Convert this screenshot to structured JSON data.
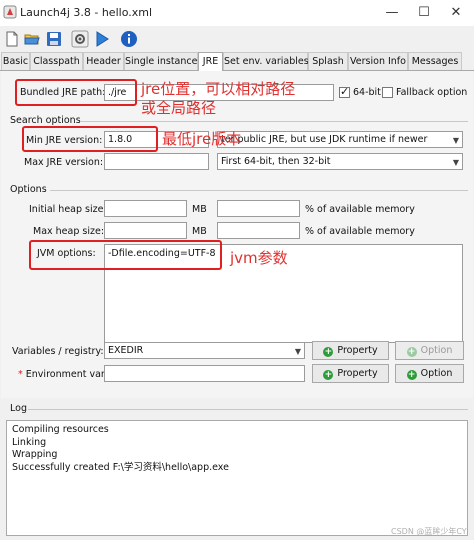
{
  "window": {
    "title": "Launch4j 3.8 - hello.xml"
  },
  "tabs": [
    {
      "label": "Basic"
    },
    {
      "label": "Classpath"
    },
    {
      "label": "Header"
    },
    {
      "label": "Single instance"
    },
    {
      "label": "JRE"
    },
    {
      "label": "Set env. variables"
    },
    {
      "label": "Splash"
    },
    {
      "label": "Version Info"
    },
    {
      "label": "Messages"
    }
  ],
  "jre": {
    "bundled_label": "Bundled JRE path:",
    "bundled_value": "./jre",
    "bit64_label": "64-bit",
    "bit64_checked": true,
    "fallback_label": "Fallback option",
    "fallback_checked": false
  },
  "search": {
    "section_label": "Search options",
    "min_label": "Min JRE version:",
    "min_value": "1.8.0",
    "max_label": "Max JRE version:",
    "max_value": "",
    "jre_pref": "ter public JRE, but use JDK runtime if newer",
    "arch_pref": "First 64-bit, then 32-bit"
  },
  "options": {
    "section_label": "Options",
    "initial_heap_label": "Initial heap size:",
    "max_heap_label": "Max heap size:",
    "mb_label": "MB",
    "pct_label": "% of available memory",
    "jvm_label": "JVM options:",
    "jvm_value": "-Dfile.encoding=UTF-8"
  },
  "vars": {
    "registry_label": "Variables / registry:",
    "registry_value": "EXEDIR",
    "env_label": "Environment var:",
    "property_label": "Property",
    "option_label": "Option"
  },
  "log": {
    "section_label": "Log",
    "lines": "Compiling resources\nLinking\nWrapping\nSuccessfully created F:\\学习资料\\hello\\app.exe"
  },
  "annotations": {
    "jre_note_line1": "jre位置，可以相对路径",
    "jre_note_line2": "或全局路径",
    "min_note": "最低jre版本",
    "jvm_note": "jvm参数"
  },
  "watermark": "CSDN @蓝眸少年CY",
  "colors": {
    "annotation_red": "#e02020",
    "property_green": "#2e9c3a"
  }
}
